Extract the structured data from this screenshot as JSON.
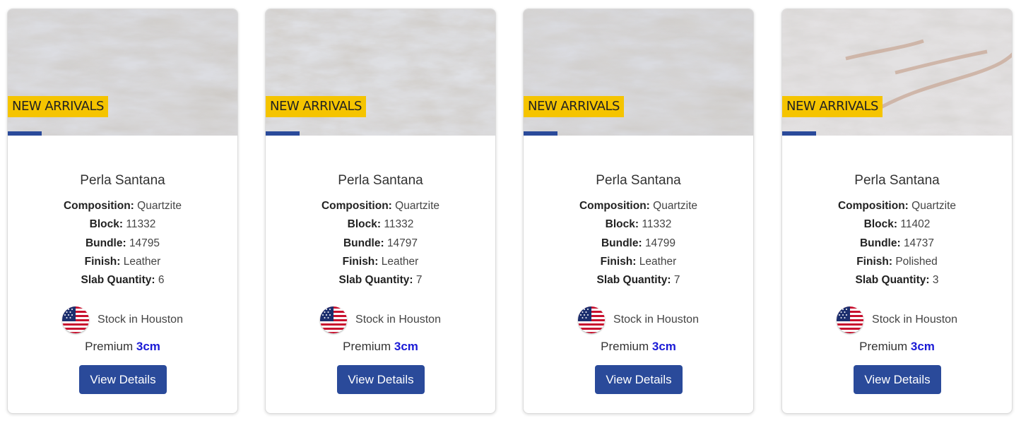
{
  "theme": {
    "badge_color": "#f5c400",
    "button_color": "#2a4a9a",
    "thickness_color": "#1a1ad6"
  },
  "labels": {
    "composition": "Composition:",
    "block": "Block:",
    "bundle": "Bundle:",
    "finish": "Finish:",
    "slab_quantity": "Slab Quantity:"
  },
  "cards": [
    {
      "badge": "NEW ARRIVALS",
      "title": "Perla Santana",
      "composition": "Quartzite",
      "block": "11332",
      "bundle": "14795",
      "finish": "Leather",
      "slab_quantity": "6",
      "flag_icon": "us-flag-icon",
      "stock": "Stock in Houston",
      "grade": "Premium",
      "thickness": "3cm",
      "button": "View Details"
    },
    {
      "badge": "NEW ARRIVALS",
      "title": "Perla Santana",
      "composition": "Quartzite",
      "block": "11332",
      "bundle": "14797",
      "finish": "Leather",
      "slab_quantity": "7",
      "flag_icon": "us-flag-icon",
      "stock": "Stock in Houston",
      "grade": "Premium",
      "thickness": "3cm",
      "button": "View Details"
    },
    {
      "badge": "NEW ARRIVALS",
      "title": "Perla Santana",
      "composition": "Quartzite",
      "block": "11332",
      "bundle": "14799",
      "finish": "Leather",
      "slab_quantity": "7",
      "flag_icon": "us-flag-icon",
      "stock": "Stock in Houston",
      "grade": "Premium",
      "thickness": "3cm",
      "button": "View Details"
    },
    {
      "badge": "NEW ARRIVALS",
      "title": "Perla Santana",
      "composition": "Quartzite",
      "block": "11402",
      "bundle": "14737",
      "finish": "Polished",
      "slab_quantity": "3",
      "flag_icon": "us-flag-icon",
      "stock": "Stock in Houston",
      "grade": "Premium",
      "thickness": "3cm",
      "button": "View Details"
    }
  ]
}
